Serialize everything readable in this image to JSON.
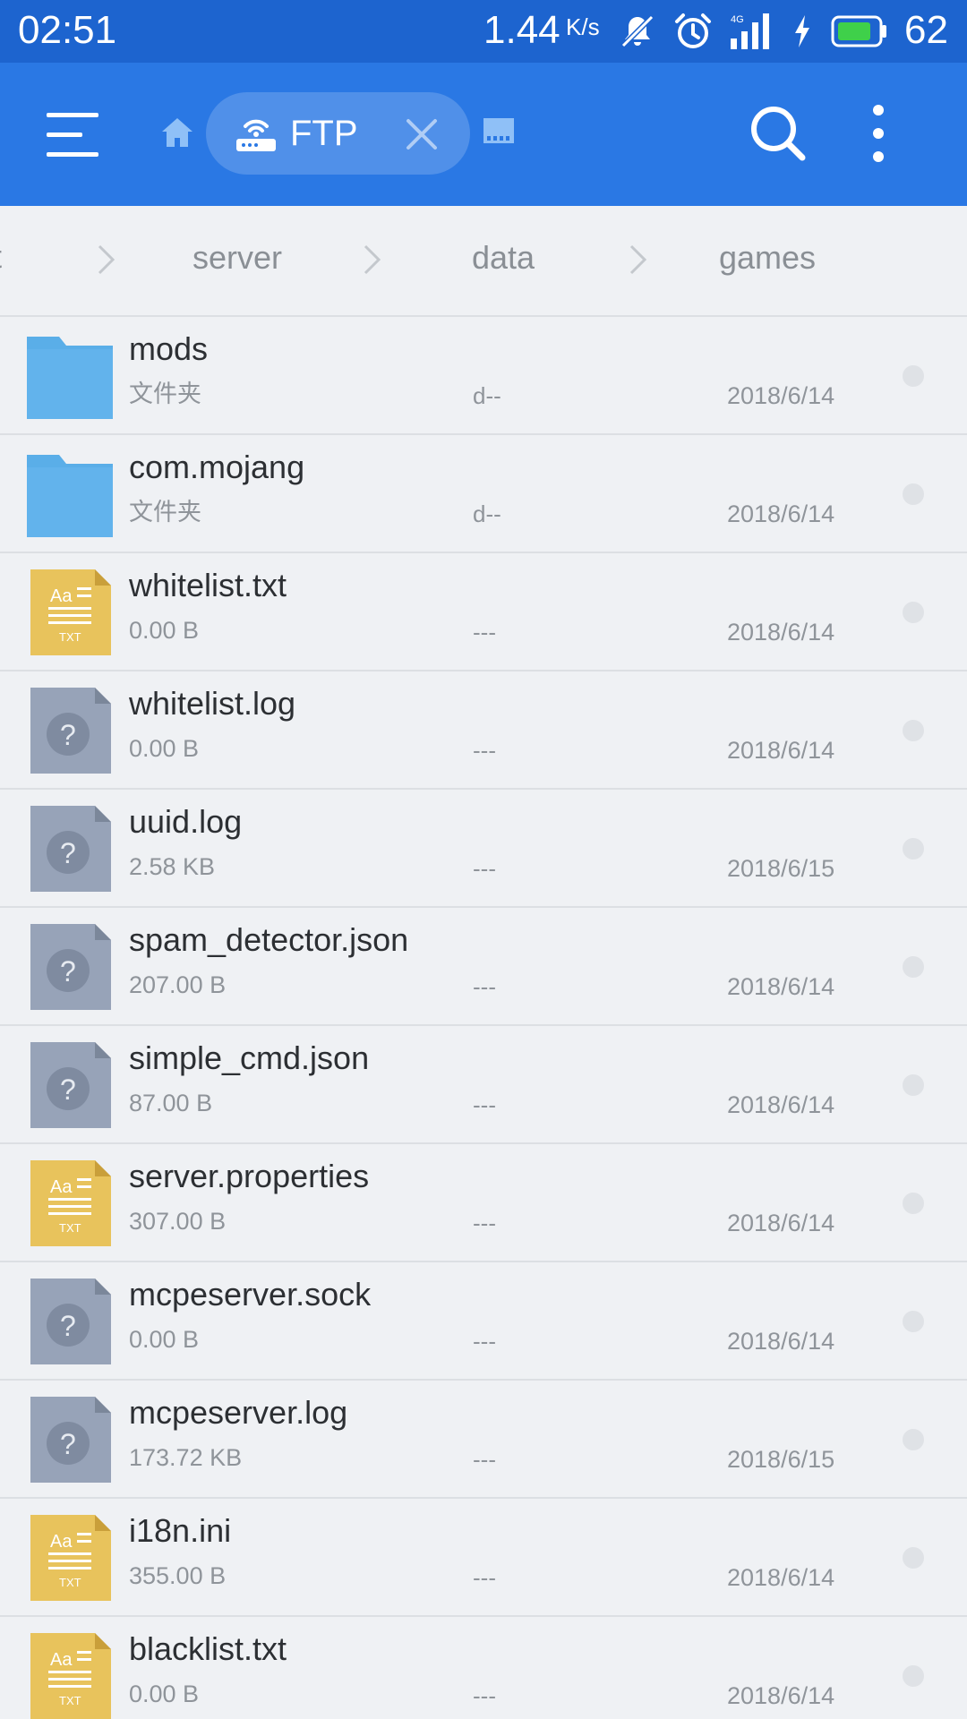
{
  "status_bar": {
    "time": "02:51",
    "network_speed": "1.44",
    "network_speed_unit": "K/s",
    "battery_level": "62",
    "icons": [
      "mute-icon",
      "alarm-icon",
      "signal-4g-icon",
      "charging-icon",
      "battery-icon"
    ]
  },
  "toolbar": {
    "tab_label": "FTP",
    "icons": [
      "menu-icon",
      "home-icon",
      "ftp-router-icon",
      "close-icon",
      "storage-icon",
      "search-icon",
      "more-icon"
    ],
    "accent_color": "#2a78e4",
    "status_bar_color": "#1d64cf"
  },
  "breadcrumb": {
    "edge_text": "t",
    "items": [
      "server",
      "data",
      "games"
    ]
  },
  "files": [
    {
      "name": "mods",
      "meta": "文件夹",
      "perm": "d--",
      "date": "2018/6/14",
      "type": "folder"
    },
    {
      "name": "com.mojang",
      "meta": "文件夹",
      "perm": "d--",
      "date": "2018/6/14",
      "type": "folder"
    },
    {
      "name": "whitelist.txt",
      "meta": "0.00 B",
      "perm": "---",
      "date": "2018/6/14",
      "type": "txt"
    },
    {
      "name": "whitelist.log",
      "meta": "0.00 B",
      "perm": "---",
      "date": "2018/6/14",
      "type": "unknown"
    },
    {
      "name": "uuid.log",
      "meta": "2.58 KB",
      "perm": "---",
      "date": "2018/6/15",
      "type": "unknown"
    },
    {
      "name": "spam_detector.json",
      "meta": "207.00 B",
      "perm": "---",
      "date": "2018/6/14",
      "type": "unknown"
    },
    {
      "name": "simple_cmd.json",
      "meta": "87.00 B",
      "perm": "---",
      "date": "2018/6/14",
      "type": "unknown"
    },
    {
      "name": "server.properties",
      "meta": "307.00 B",
      "perm": "---",
      "date": "2018/6/14",
      "type": "txt"
    },
    {
      "name": "mcpeserver.sock",
      "meta": "0.00 B",
      "perm": "---",
      "date": "2018/6/14",
      "type": "unknown"
    },
    {
      "name": "mcpeserver.log",
      "meta": "173.72 KB",
      "perm": "---",
      "date": "2018/6/15",
      "type": "unknown"
    },
    {
      "name": "i18n.ini",
      "meta": "355.00 B",
      "perm": "---",
      "date": "2018/6/14",
      "type": "txt"
    },
    {
      "name": "blacklist.txt",
      "meta": "0.00 B",
      "perm": "---",
      "date": "2018/6/14",
      "type": "txt"
    }
  ],
  "file_icon_labels": {
    "txt_top": "Aa",
    "txt_bottom": "TXT",
    "unknown": "?"
  },
  "colors": {
    "folder": "#5aaee8",
    "txt": "#e8c35c",
    "unknown": "#97a3b8"
  }
}
